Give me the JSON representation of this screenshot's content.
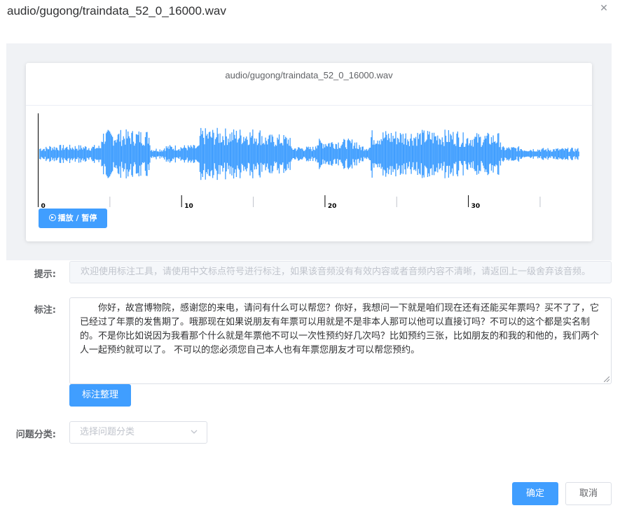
{
  "dialog": {
    "title": "audio/gugong/traindata_52_0_16000.wav",
    "close_icon": "close-icon"
  },
  "player": {
    "filename": "audio/gugong/traindata_52_0_16000.wav",
    "timeline_labels": [
      "0",
      "10",
      "20",
      "30"
    ],
    "play_button_label": "播放 / 暂停",
    "wave_color": "#409eff"
  },
  "form": {
    "hint_label": "提示:",
    "hint_text": "欢迎使用标注工具，请使用中文标点符号进行标注，如果该音频没有有效内容或者音频内容不清晰，请返回上一级舍弃该音频。",
    "annotation_label": "标注:",
    "annotation_text": "你好，故宫博物院，感谢您的来电，请问有什么可以帮您？你好，我想问一下就是咱们现在还有还能买年票吗？买不了了，它已经过了年票的发售期了。哦那现在如果说朋友有年票可以用就是不是非本人那可以他可以直接订吗？不可以的这个都是实名制的。不是你比如说因为我看那个什么就是年票他不可以一次性预约好几次吗？比如预约三张，比如朋友的和我的和他的，我们两个人一起预约就可以了。 不可以的您必须您自己本人也有年票您朋友才可以帮您预约。",
    "tidy_button_label": "标注整理",
    "category_label": "问题分类:",
    "category_placeholder": "选择问题分类"
  },
  "footer": {
    "confirm_label": "确定",
    "cancel_label": "取消"
  },
  "colors": {
    "primary": "#409eff",
    "panel_bg": "#f0f2f5"
  }
}
